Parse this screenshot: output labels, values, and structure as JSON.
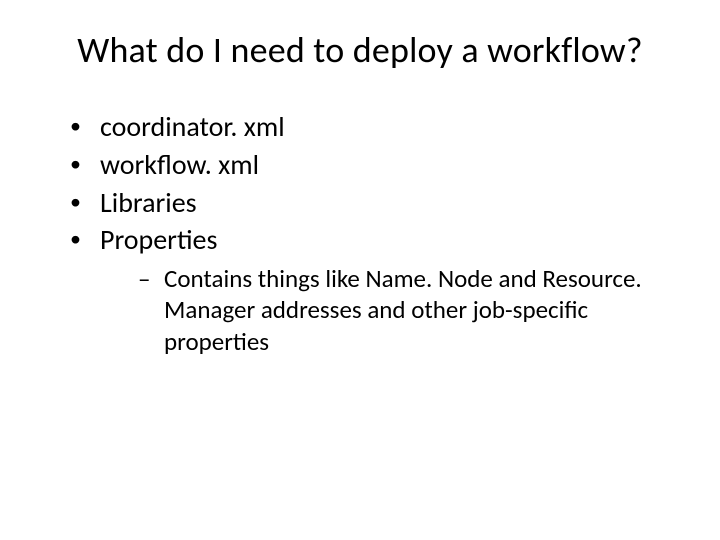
{
  "title": "What do I need to deploy a workflow?",
  "items": [
    {
      "label": "coordinator. xml"
    },
    {
      "label": "workflow. xml"
    },
    {
      "label": "Libraries"
    },
    {
      "label": "Properties",
      "sub": [
        {
          "label": "Contains things like Name. Node and Resource. Manager addresses and other job-specific properties"
        }
      ]
    }
  ]
}
